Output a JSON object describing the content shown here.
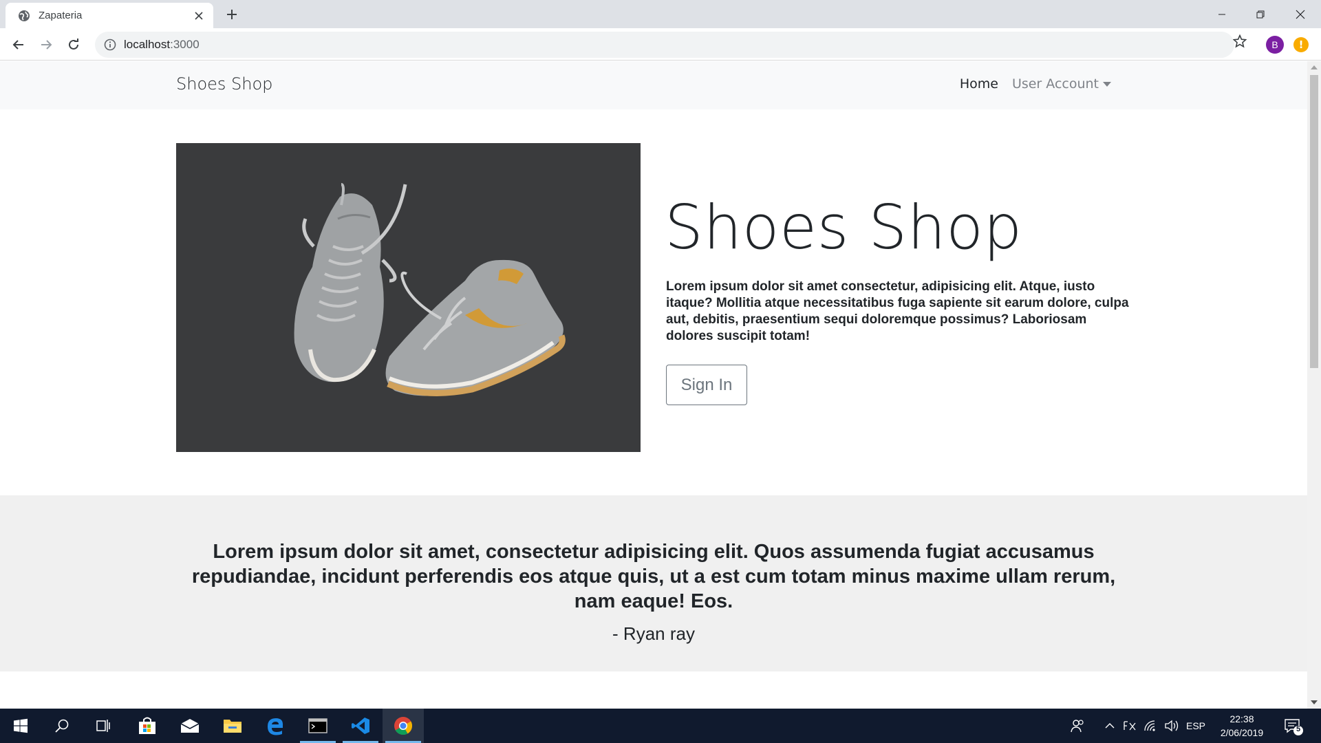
{
  "browser": {
    "tab_title": "Zapateria",
    "url_host": "localhost",
    "url_port": ":3000",
    "profile_initial": "B",
    "update_badge": "!"
  },
  "site": {
    "brand": "Shoes Shop",
    "nav": {
      "home": "Home",
      "account": "User Account"
    },
    "hero": {
      "title": "Shoes Shop",
      "text": "Lorem ipsum dolor sit amet consectetur, adipisicing elit. Atque, iusto itaque? Mollitia atque necessitatibus fuga sapiente sit earum dolore, culpa aut, debitis, praesentium sequi doloremque possimus? Laboriosam dolores suscipit totam!",
      "button": "Sign In"
    },
    "quote": {
      "text": "Lorem ipsum dolor sit amet, consectetur adipisicing elit. Quos assumenda fugiat accusamus repudiandae, incidunt perferendis eos atque quis, ut a est cum totam minus maxime ullam rerum, nam eaque! Eos.",
      "author": "- Ryan ray"
    }
  },
  "taskbar": {
    "language": "ESP",
    "time": "22:38",
    "date": "2/06/2019",
    "notification_count": "5"
  },
  "colors": {
    "taskbar": "#101a2e",
    "navbar": "#f8f9fa",
    "quote_bg": "#f0f0f0",
    "profile": "#7b1fa2",
    "update": "#f9ab00"
  }
}
